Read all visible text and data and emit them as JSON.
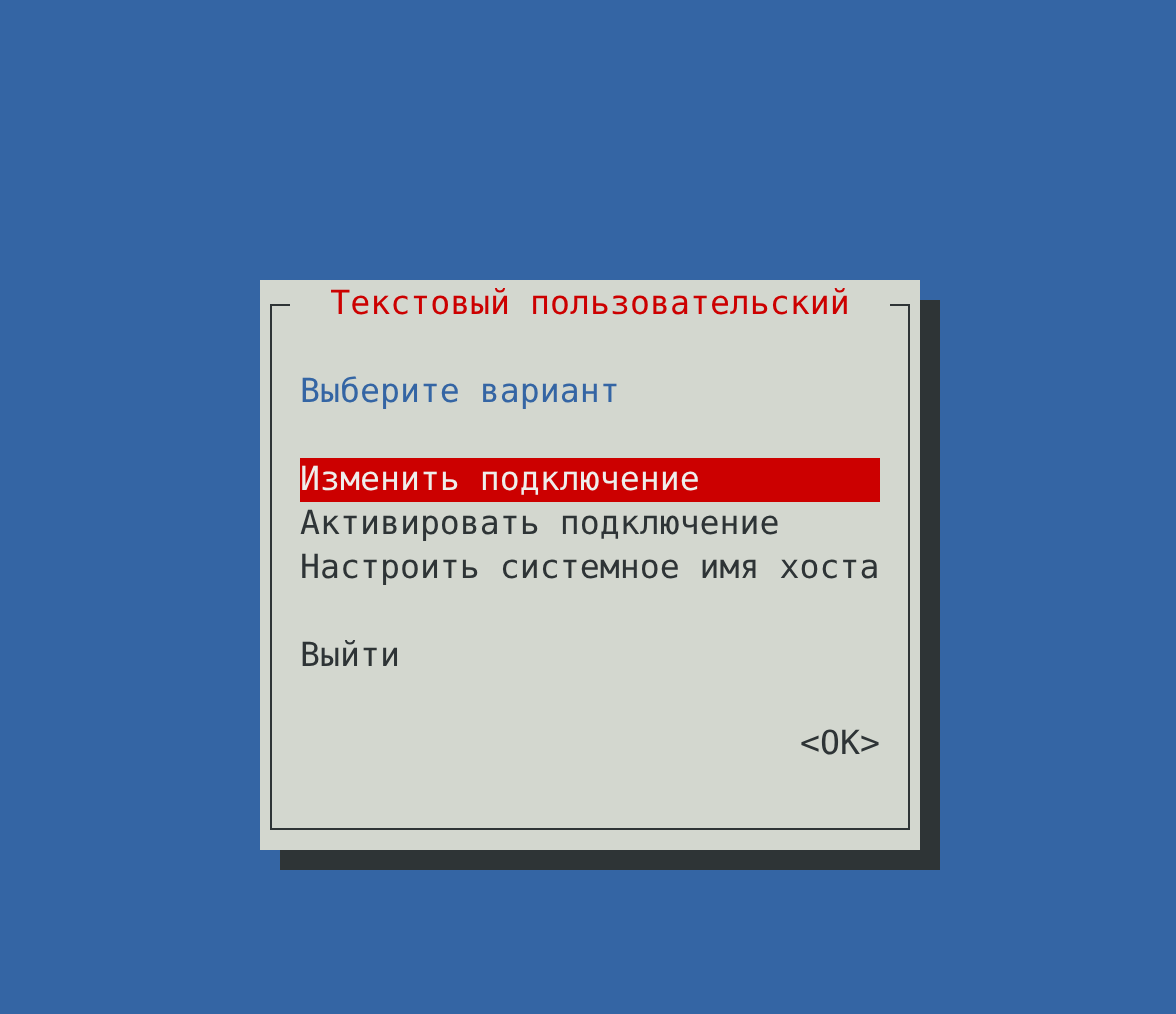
{
  "dialog": {
    "title": "Текстовый пользовательский",
    "prompt": "Выберите вариант",
    "menu_groups": [
      {
        "items": [
          {
            "label": "Изменить подключение",
            "selected": true
          },
          {
            "label": "Активировать подключение",
            "selected": false
          },
          {
            "label": "Настроить системное имя хоста",
            "selected": false
          }
        ]
      },
      {
        "items": [
          {
            "label": "Выйти",
            "selected": false
          }
        ]
      }
    ],
    "button": "<OK>"
  }
}
